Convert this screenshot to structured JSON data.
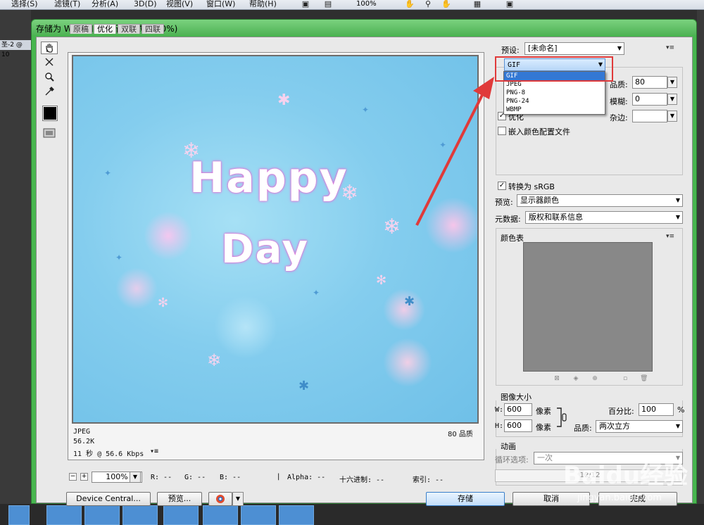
{
  "app": {
    "menus": [
      "选择(S)",
      "滤镜(T)",
      "分析(A)",
      "3D(D)",
      "视图(V)",
      "窗口(W)",
      "帮助(H)"
    ],
    "zoom": "100%",
    "doc_tab": "圣-2 @ 10"
  },
  "dialog": {
    "title": "存储为 Web 和设备所用格式 (100%)",
    "tabs": [
      "原稿",
      "优化",
      "双联",
      "四联"
    ],
    "active_tab": "优化",
    "preview": {
      "line1": "Happy",
      "line2": "Day",
      "format": "JPEG",
      "size": "56.2K",
      "time": "11 秒 @ 56.6 Kbps",
      "quality": "80 品质"
    },
    "status": {
      "zoom": "100%",
      "r": "R: --",
      "g": "G: --",
      "b": "B: --",
      "alpha": "Alpha: --",
      "hex": "十六进制: --",
      "index": "索引: --"
    },
    "buttons": {
      "device_central": "Device Central...",
      "preview": "预览...",
      "save": "存储",
      "cancel": "取消",
      "done": "完成"
    },
    "settings": {
      "preset_label": "预设:",
      "preset_value": "[未命名]",
      "format_value": "GIF",
      "format_options": [
        "GIF",
        "JPEG",
        "PNG-8",
        "PNG-24",
        "WBMP"
      ],
      "quality_label": "品质:",
      "quality_value": "80",
      "blur_label": "模糊:",
      "blur_value": "0",
      "matte_label": "杂边:",
      "optimized_label": "优化",
      "embed_profile_label": "嵌入颜色配置文件",
      "convert_srgb_label": "转换为 sRGB",
      "preview_label": "预览:",
      "preview_value": "显示器颜色",
      "metadata_label": "元数据:",
      "metadata_value": "版权和联系信息",
      "color_table_label": "颜色表",
      "image_size_label": "图像大小",
      "w_label": "W:",
      "w_value": "600",
      "h_label": "H:",
      "h_value": "600",
      "pixels_unit": "像素",
      "percent_label": "百分比:",
      "percent_value": "100",
      "percent_unit": "%",
      "resample_label": "品质:",
      "resample_value": "两次立方",
      "animation_label": "动画",
      "loop_label": "循环选项:",
      "loop_value": "一次",
      "frame_counter": "12/12"
    }
  },
  "watermark": {
    "brand": "Baidu经验",
    "url": "jingyan.baidu.com"
  },
  "colors": {
    "titlebar": "#4fb355",
    "accent_red": "#e03a3a",
    "selection_blue": "#3378d4"
  }
}
